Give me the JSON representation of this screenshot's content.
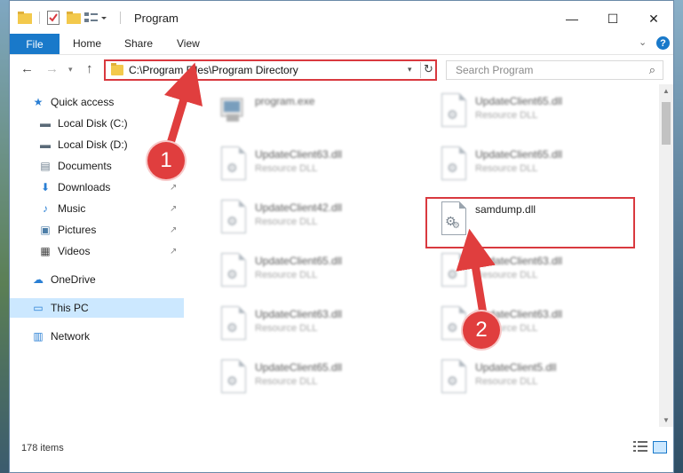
{
  "window": {
    "title": "Program",
    "controls": {
      "minimize": "—",
      "maximize": "☐",
      "close": "✕"
    }
  },
  "ribbon": {
    "file": "File",
    "tabs": [
      "Home",
      "Share",
      "View"
    ],
    "help_glyph": "?",
    "expand_glyph": "⌄"
  },
  "address": {
    "path": "C:\\Program Files\\Program Directory",
    "refresh_glyph": "↻",
    "dropdown_glyph": "▾",
    "back_glyph": "←",
    "forward_glyph": "→",
    "recent_glyph": "▾",
    "up_glyph": "↑"
  },
  "search": {
    "placeholder": "Search Program",
    "icon_glyph": "⌕"
  },
  "sidebar": {
    "items": [
      {
        "label": "Quick access",
        "icon": "star-icon",
        "glyph": "★",
        "color": "#2a7fd4",
        "pinned": false
      },
      {
        "label": "Local Disk (C:)",
        "icon": "drive-icon",
        "glyph": "▬",
        "color": "#5a6a78",
        "pinned": false
      },
      {
        "label": "Local Disk (D:)",
        "icon": "drive-icon",
        "glyph": "▬",
        "color": "#5a6a78",
        "pinned": false
      },
      {
        "label": "Documents",
        "icon": "documents-icon",
        "glyph": "▤",
        "color": "#6b7c8c",
        "pinned": false
      },
      {
        "label": "Downloads",
        "icon": "download-icon",
        "glyph": "⬇",
        "color": "#2a7fd4",
        "pinned": true
      },
      {
        "label": "Music",
        "icon": "music-icon",
        "glyph": "♪",
        "color": "#2a7fd4",
        "pinned": true
      },
      {
        "label": "Pictures",
        "icon": "pictures-icon",
        "glyph": "▣",
        "color": "#4d7ea8",
        "pinned": true
      },
      {
        "label": "Videos",
        "icon": "videos-icon",
        "glyph": "▦",
        "color": "#444444",
        "pinned": true
      },
      {
        "label": "OneDrive",
        "icon": "cloud-icon",
        "glyph": "☁",
        "color": "#2a7fd4",
        "pinned": false
      },
      {
        "label": "This PC",
        "icon": "computer-icon",
        "glyph": "▭",
        "color": "#2a7fd4",
        "pinned": false
      },
      {
        "label": "Network",
        "icon": "network-icon",
        "glyph": "▥",
        "color": "#2a7fd4",
        "pinned": false
      }
    ],
    "pin_glyph": "📌",
    "selected": "This PC"
  },
  "files": [
    {
      "name": "program.exe",
      "type": "",
      "kind": "exe",
      "blurred": true
    },
    {
      "name": "UpdateClient65.dll",
      "type": "Resource DLL",
      "kind": "dll",
      "blurred": true
    },
    {
      "name": "UpdateClient63.dll",
      "type": "Resource DLL",
      "kind": "dll",
      "blurred": true
    },
    {
      "name": "UpdateClient65.dll",
      "type": "Resource DLL",
      "kind": "dll",
      "blurred": true
    },
    {
      "name": "UpdateClient42.dll",
      "type": "Resource DLL",
      "kind": "dll",
      "blurred": true
    },
    {
      "name": "samdump.dll",
      "type": "",
      "kind": "dll",
      "blurred": false
    },
    {
      "name": "UpdateClient65.dll",
      "type": "Resource DLL",
      "kind": "dll",
      "blurred": true
    },
    {
      "name": "UpdateClient63.dll",
      "type": "Resource DLL",
      "kind": "dll",
      "blurred": true
    },
    {
      "name": "UpdateClient63.dll",
      "type": "Resource DLL",
      "kind": "dll",
      "blurred": true
    },
    {
      "name": "UpdateClient63.dll",
      "type": "Resource DLL",
      "kind": "dll",
      "blurred": true
    },
    {
      "name": "UpdateClient65.dll",
      "type": "Resource DLL",
      "kind": "dll",
      "blurred": true
    },
    {
      "name": "UpdateClient5.dll",
      "type": "Resource DLL",
      "kind": "dll",
      "blurred": true
    }
  ],
  "status": {
    "item_count": "178 items"
  },
  "annotations": {
    "step1": "1",
    "step2": "2",
    "color": "#e03e3e"
  }
}
